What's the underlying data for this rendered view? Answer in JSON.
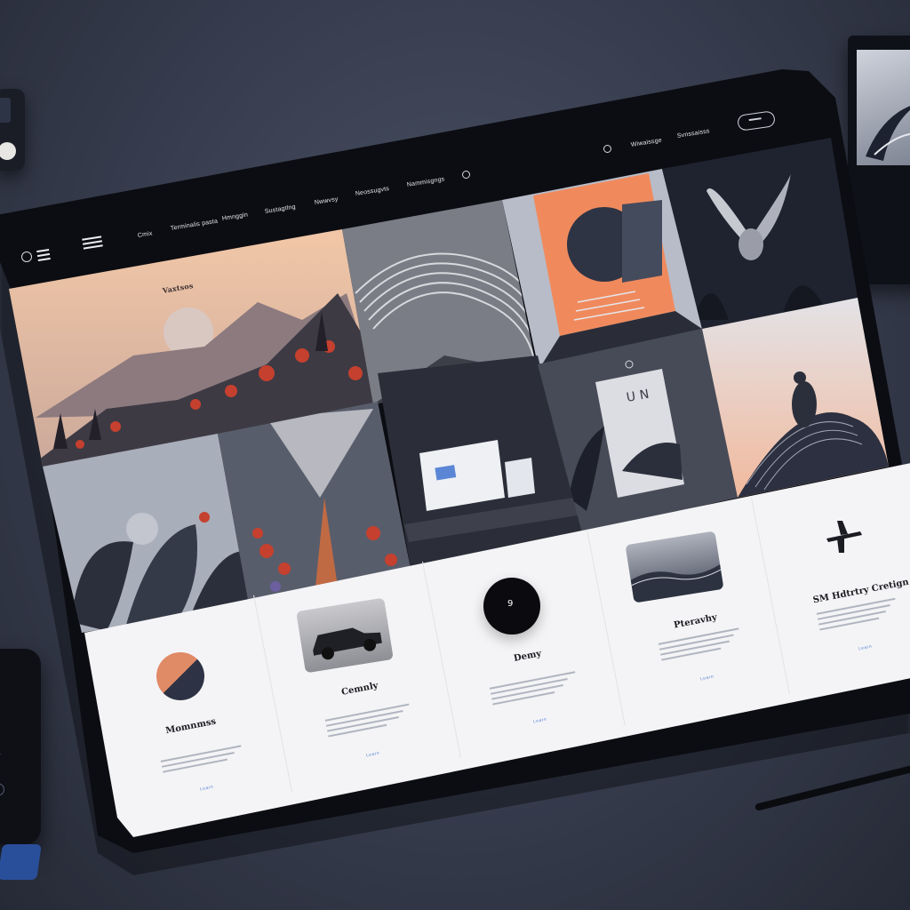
{
  "nav": {
    "items": [
      "Cmix",
      "Terminalis pasta",
      "Hmnggin",
      "Sustagtlng",
      "Nwwvsy",
      "Neossugvts",
      "Nammisgngs",
      "Wiwaissge",
      "Svnssaisss"
    ],
    "logo_text": "Vaxtsos"
  },
  "gallery": {
    "tiles": [
      {
        "name": "mountain-sunset",
        "caption": "Vaxtsos"
      },
      {
        "name": "wave-sculpture",
        "caption": ""
      },
      {
        "name": "sunset-doorway",
        "caption": ""
      },
      {
        "name": "winged-creature",
        "caption": ""
      },
      {
        "name": "dark-leaves",
        "caption": ""
      },
      {
        "name": "flower-path",
        "caption": ""
      },
      {
        "name": "desk-workspace",
        "caption": ""
      },
      {
        "name": "book-poster",
        "caption": "U N"
      },
      {
        "name": "bird-on-hills",
        "caption": ""
      }
    ]
  },
  "cards": [
    {
      "title": "Momnmss",
      "icon": "split-circle-icon",
      "link": "Learn"
    },
    {
      "title": "Cemnly",
      "icon": "vintage-car-image",
      "link": "Learn"
    },
    {
      "title": "Demy",
      "icon": "black-circle-icon",
      "link": "Learn"
    },
    {
      "title": "Pteravhy",
      "icon": "ocean-wave-image",
      "link": "Learn"
    },
    {
      "title": "SM Hdtrtry Cretign",
      "icon": "plane-icon",
      "link": "Learn"
    }
  ],
  "colors": {
    "bezel": "#0c0d12",
    "desk": "#363c4d",
    "card_bg": "#f4f4f6",
    "accent_link": "#5b86d6",
    "sunset": "#f08a5d"
  }
}
